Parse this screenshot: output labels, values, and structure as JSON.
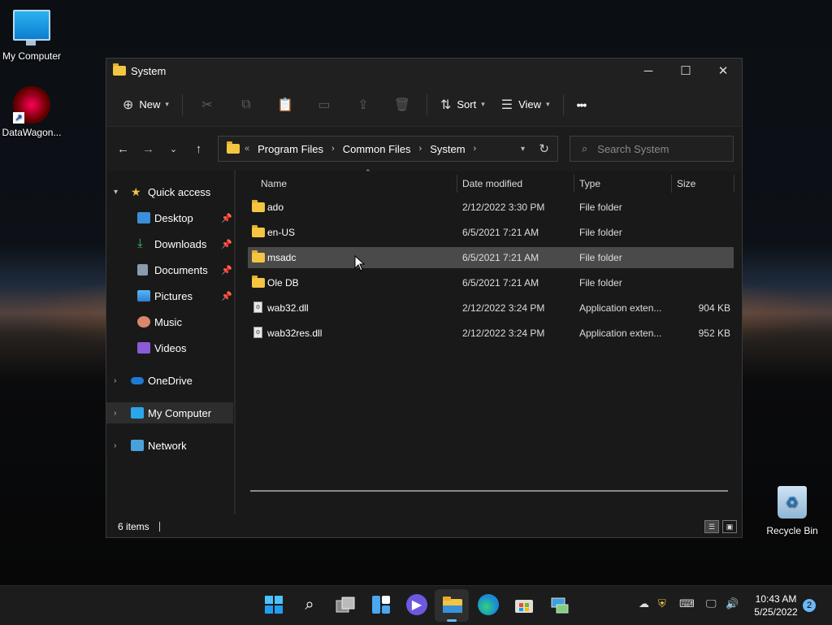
{
  "desktop": {
    "icons": [
      {
        "label": "My Computer"
      },
      {
        "label": "DataWagon..."
      },
      {
        "label": "Recycle Bin"
      }
    ]
  },
  "window": {
    "title": "System",
    "controls": {
      "minimize": "─",
      "maximize": "☐",
      "close": "✕"
    }
  },
  "toolbar": {
    "new_label": "New",
    "sort_label": "Sort",
    "view_label": "View",
    "more_label": "•••"
  },
  "address": {
    "overflow": "«",
    "crumbs": [
      "Program Files",
      "Common Files",
      "System"
    ]
  },
  "search": {
    "placeholder": "Search System"
  },
  "nav": {
    "quick_access": "Quick access",
    "items": [
      {
        "label": "Desktop",
        "icon": "desktop-folder-icon",
        "pinned": true
      },
      {
        "label": "Downloads",
        "icon": "downloads-icon",
        "pinned": true
      },
      {
        "label": "Documents",
        "icon": "documents-icon",
        "pinned": true
      },
      {
        "label": "Pictures",
        "icon": "pictures-icon",
        "pinned": true
      },
      {
        "label": "Music",
        "icon": "music-icon",
        "pinned": false
      },
      {
        "label": "Videos",
        "icon": "videos-icon",
        "pinned": false
      }
    ],
    "onedrive": "OneDrive",
    "my_computer": "My Computer",
    "network": "Network"
  },
  "columns": {
    "name": "Name",
    "date": "Date modified",
    "type": "Type",
    "size": "Size"
  },
  "files": [
    {
      "name": "ado",
      "date": "2/12/2022 3:30 PM",
      "type": "File folder",
      "size": "",
      "kind": "folder"
    },
    {
      "name": "en-US",
      "date": "6/5/2021 7:21 AM",
      "type": "File folder",
      "size": "",
      "kind": "folder"
    },
    {
      "name": "msadc",
      "date": "6/5/2021 7:21 AM",
      "type": "File folder",
      "size": "",
      "kind": "folder",
      "selected": true
    },
    {
      "name": "Ole DB",
      "date": "6/5/2021 7:21 AM",
      "type": "File folder",
      "size": "",
      "kind": "folder"
    },
    {
      "name": "wab32.dll",
      "date": "2/12/2022 3:24 PM",
      "type": "Application exten...",
      "size": "904 KB",
      "kind": "dll"
    },
    {
      "name": "wab32res.dll",
      "date": "2/12/2022 3:24 PM",
      "type": "Application exten...",
      "size": "952 KB",
      "kind": "dll"
    }
  ],
  "status": {
    "count": "6 items"
  },
  "taskbar": {
    "time": "10:43 AM",
    "date": "5/25/2022",
    "notifications": "2"
  },
  "colors": {
    "accent": "#6cb8f6",
    "folder": "#f4c542",
    "selection": "#4a4a4a"
  }
}
